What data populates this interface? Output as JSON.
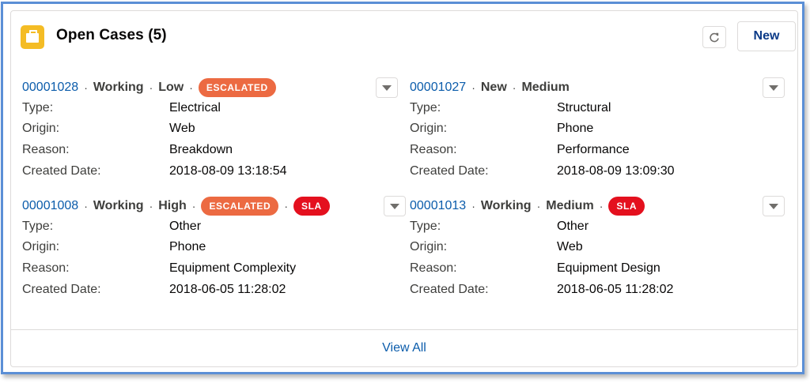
{
  "header": {
    "title": "Open Cases (5)",
    "icon": "briefcase-icon",
    "icon_color": "#f4bc25",
    "refresh_icon": "refresh-icon",
    "new_label": "New"
  },
  "labels": {
    "type": "Type:",
    "origin": "Origin:",
    "reason": "Reason:",
    "created": "Created Date:"
  },
  "cases": [
    {
      "number": "00001028",
      "status": "Working",
      "priority": "Low",
      "badges": [
        "ESCALATED"
      ],
      "type": "Electrical",
      "origin": "Web",
      "reason": "Breakdown",
      "created": "2018-08-09 13:18:54"
    },
    {
      "number": "00001027",
      "status": "New",
      "priority": "Medium",
      "badges": [],
      "type": "Structural",
      "origin": "Phone",
      "reason": "Performance",
      "created": "2018-08-09 13:09:30"
    },
    {
      "number": "00001008",
      "status": "Working",
      "priority": "High",
      "badges": [
        "ESCALATED",
        "SLA"
      ],
      "type": "Other",
      "origin": "Phone",
      "reason": "Equipment Complexity",
      "created": "2018-06-05 11:28:02"
    },
    {
      "number": "00001013",
      "status": "Working",
      "priority": "Medium",
      "badges": [
        "SLA"
      ],
      "type": "Other",
      "origin": "Web",
      "reason": "Equipment Design",
      "created": "2018-06-05 11:28:02"
    }
  ],
  "separator": "·",
  "colors": {
    "link": "#0b5cab",
    "escalated": "#ec6a42",
    "sla": "#e4101e",
    "frame": "#5b8fd6"
  },
  "footer": {
    "view_all": "View All"
  }
}
